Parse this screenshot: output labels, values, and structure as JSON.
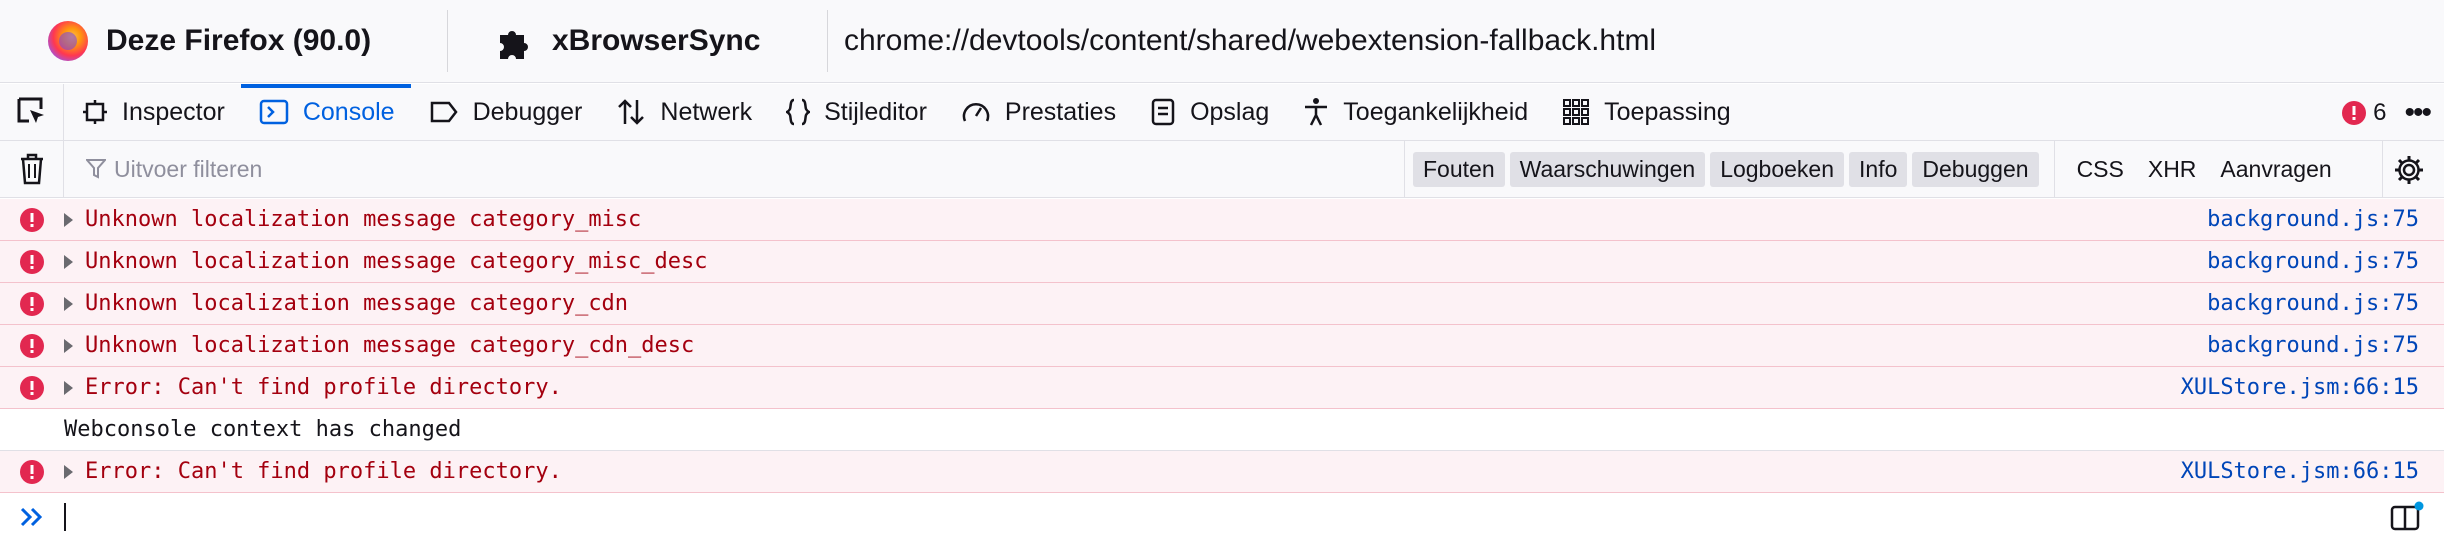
{
  "targets": {
    "firefox_label": "Deze Firefox (90.0)",
    "extension_label": "xBrowserSync",
    "url": "chrome://devtools/content/shared/webextension-fallback.html"
  },
  "tools": {
    "tabs": [
      {
        "label": "Inspector",
        "icon": "inspector-icon"
      },
      {
        "label": "Console",
        "icon": "console-icon",
        "active": true
      },
      {
        "label": "Debugger",
        "icon": "debugger-icon"
      },
      {
        "label": "Netwerk",
        "icon": "network-icon"
      },
      {
        "label": "Stijleditor",
        "icon": "style-editor-icon"
      },
      {
        "label": "Prestaties",
        "icon": "performance-icon"
      },
      {
        "label": "Opslag",
        "icon": "storage-icon"
      },
      {
        "label": "Toegankelijkheid",
        "icon": "accessibility-icon"
      },
      {
        "label": "Toepassing",
        "icon": "application-icon"
      }
    ],
    "error_count": "6",
    "more_label": "•••"
  },
  "filter": {
    "placeholder": "Uitvoer filteren",
    "levels": [
      "Fouten",
      "Waarschuwingen",
      "Logboeken",
      "Info",
      "Debuggen"
    ],
    "net": [
      "CSS",
      "XHR",
      "Aanvragen"
    ]
  },
  "messages": [
    {
      "type": "error",
      "text": "Unknown localization message category_misc",
      "source": "background.js:75"
    },
    {
      "type": "error",
      "text": "Unknown localization message category_misc_desc",
      "source": "background.js:75"
    },
    {
      "type": "error",
      "text": "Unknown localization message category_cdn",
      "source": "background.js:75"
    },
    {
      "type": "error",
      "text": "Unknown localization message category_cdn_desc",
      "source": "background.js:75"
    },
    {
      "type": "error",
      "text": "Error: Can't find profile directory.",
      "source": "XULStore.jsm:66:15"
    },
    {
      "type": "log",
      "text": "Webconsole context has changed",
      "source": ""
    },
    {
      "type": "error",
      "text": "Error: Can't find profile directory.",
      "source": "XULStore.jsm:66:15"
    }
  ],
  "colors": {
    "accent": "#0061e0",
    "error_text": "#a4000f",
    "error_bg": "#fdf2f5",
    "error_icon": "#e22850",
    "source_link": "#0046b8"
  }
}
